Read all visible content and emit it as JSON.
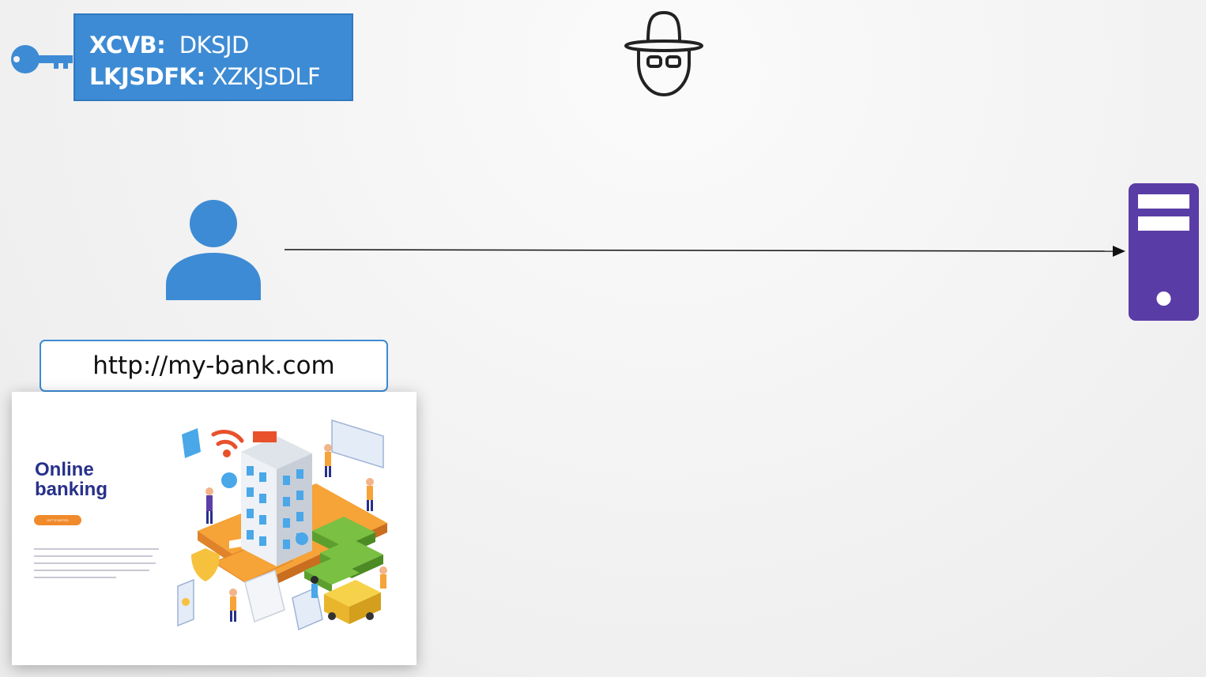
{
  "credentials": {
    "rows": [
      {
        "key": "XCVB:",
        "value": "DKSJD"
      },
      {
        "key": "LKJSDFK:",
        "value": "XZKJSDLF"
      }
    ]
  },
  "browser": {
    "url": "http://my-bank.com"
  },
  "website": {
    "title": "Online banking",
    "button_label": "GET STARTED"
  },
  "colors": {
    "accent_blue": "#3d8bd4",
    "server_purple": "#5a3ca6",
    "site_title": "#27308a",
    "cta_orange": "#f08a2b"
  },
  "icons": {
    "key": "key-icon",
    "hacker": "hacker-icon",
    "user": "user-icon",
    "server": "server-icon",
    "arrow": "arrow-right"
  }
}
